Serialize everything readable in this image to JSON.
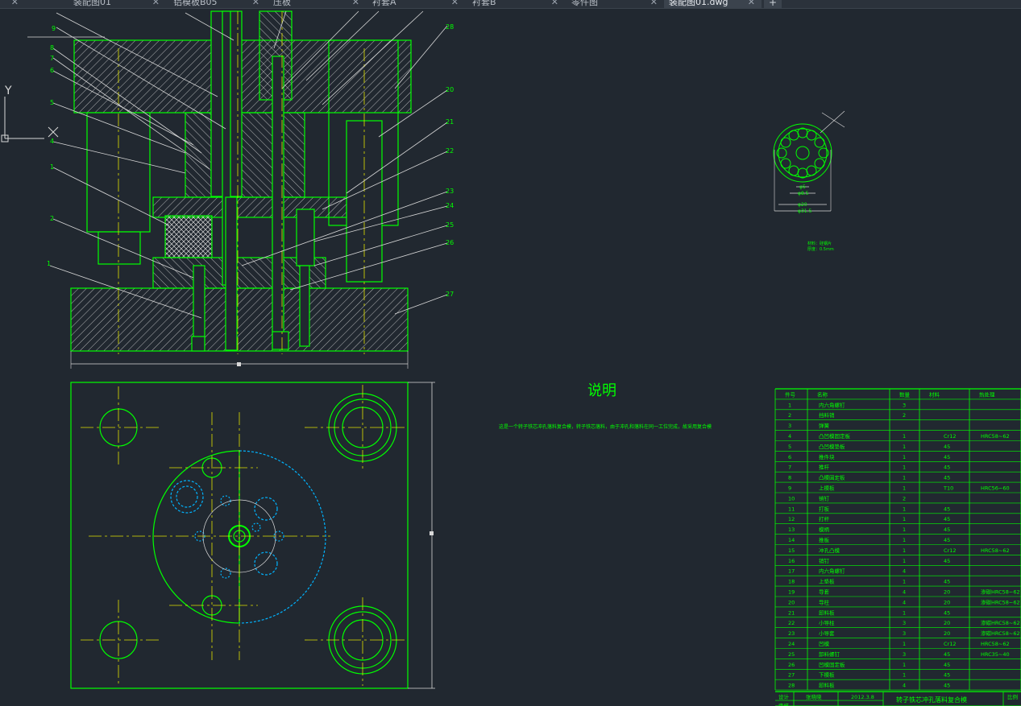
{
  "tabs": [
    {
      "label": "0",
      "active": false
    },
    {
      "label": "装配图01",
      "active": false
    },
    {
      "label": "铝模板B05",
      "active": false
    },
    {
      "label": "压板",
      "active": false
    },
    {
      "label": "衬套A",
      "active": false
    },
    {
      "label": "衬套B",
      "active": false
    },
    {
      "label": "零件图",
      "active": false
    },
    {
      "label": "装配图01.dwg",
      "active": true
    }
  ],
  "new_tab_symbol": "+",
  "ucs": {
    "y_label": "Y",
    "x_label": "X"
  },
  "notes": {
    "title": "说明",
    "body": "这是一个转子铁芯冲孔落料复合模，转子铁芯落料，由于冲孔和落料在同一工位完成，故采用复合模"
  },
  "part_dims": {
    "d1": "φ5",
    "d2": "φ8.5",
    "d3": "φ20",
    "d4": "φ31.5",
    "note1": "材料：硅钢片",
    "note2": "厚度：0.5mm"
  },
  "balloons_left": [
    "9",
    "8",
    "7",
    "6",
    "5",
    "4",
    "1",
    "2",
    "1"
  ],
  "balloons_right": [
    "28",
    "20",
    "21",
    "22",
    "23",
    "24",
    "25",
    "26",
    "27"
  ],
  "bom": {
    "headers": [
      "件号",
      "名称",
      "数量",
      "材料",
      "热处理"
    ],
    "rows": [
      [
        "1",
        "内六角螺钉",
        "3",
        "",
        ""
      ],
      [
        "2",
        "挡料销",
        "2",
        "",
        ""
      ],
      [
        "3",
        "弹簧",
        "",
        "",
        ""
      ],
      [
        "4",
        "凸凹模固定板",
        "1",
        "Cr12",
        "HRC58~62"
      ],
      [
        "5",
        "凸凹模垫板",
        "1",
        "45",
        ""
      ],
      [
        "6",
        "推件块",
        "1",
        "45",
        ""
      ],
      [
        "7",
        "推杆",
        "1",
        "45",
        ""
      ],
      [
        "8",
        "凸模固定板",
        "1",
        "45",
        ""
      ],
      [
        "9",
        "上模板",
        "1",
        "T10",
        "HRC56~60"
      ],
      [
        "10",
        "销钉",
        "2",
        "",
        ""
      ],
      [
        "11",
        "打板",
        "1",
        "45",
        ""
      ],
      [
        "12",
        "打杆",
        "1",
        "45",
        ""
      ],
      [
        "13",
        "模柄",
        "1",
        "45",
        ""
      ],
      [
        "14",
        "推板",
        "1",
        "45",
        ""
      ],
      [
        "15",
        "冲孔凸模",
        "1",
        "Cr12",
        "HRC58~62"
      ],
      [
        "16",
        "销钉",
        "1",
        "45",
        ""
      ],
      [
        "17",
        "内六角螺钉",
        "4",
        "",
        ""
      ],
      [
        "18",
        "上垫板",
        "1",
        "45",
        ""
      ],
      [
        "19",
        "导套",
        "4",
        "20",
        "渗碳HRC58~62"
      ],
      [
        "20",
        "导柱",
        "4",
        "20",
        "渗碳HRC58~62"
      ],
      [
        "21",
        "卸料板",
        "1",
        "45",
        ""
      ],
      [
        "22",
        "小导柱",
        "3",
        "20",
        "渗碳HRC58~62"
      ],
      [
        "23",
        "小导套",
        "3",
        "20",
        "渗碳HRC58~62"
      ],
      [
        "24",
        "凹模",
        "1",
        "Cr12",
        "HRC58~62"
      ],
      [
        "25",
        "卸料螺钉",
        "3",
        "45",
        "HRC35~40"
      ],
      [
        "26",
        "凹模固定板",
        "1",
        "45",
        ""
      ],
      [
        "27",
        "下模板",
        "1",
        "45",
        ""
      ],
      [
        "28",
        "卸料板",
        "4",
        "45",
        ""
      ]
    ],
    "title_block": {
      "design": "设计",
      "name": "张晓晓",
      "date": "2012.3.8",
      "title": "转子铁芯冲孔落料复合模",
      "note": "比例",
      "check": "审核"
    }
  },
  "colors": {
    "line": "#00ff00",
    "center": "#e0e000",
    "hidden": "#00b4ff",
    "white": "#d8d8d8",
    "bg": "#212830"
  }
}
